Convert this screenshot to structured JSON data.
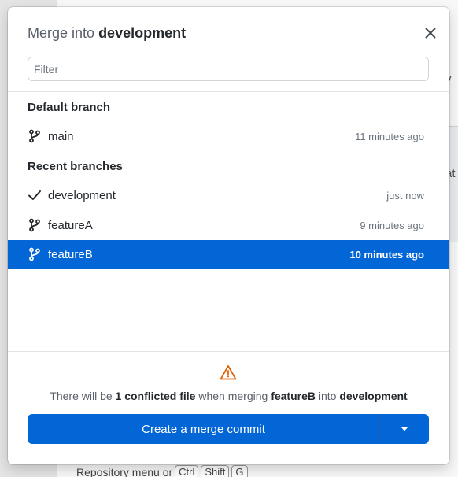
{
  "background": {
    "fragment_a": "y",
    "fragment_b": "at",
    "hint_text": "Repository menu or",
    "hint_keys": [
      "Ctrl",
      "Shift",
      "G"
    ]
  },
  "dialog": {
    "title_prefix": "Merge into",
    "title_branch": "development",
    "close_icon": "close-icon",
    "filter": {
      "placeholder": "Filter",
      "value": ""
    },
    "default_section_label": "Default branch",
    "default_branches": [
      {
        "name": "main",
        "time": "11 minutes ago",
        "icon": "git-branch-icon",
        "selected": false
      }
    ],
    "recent_section_label": "Recent branches",
    "recent_branches": [
      {
        "name": "development",
        "time": "just now",
        "icon": "check-icon",
        "selected": false
      },
      {
        "name": "featureA",
        "time": "9 minutes ago",
        "icon": "git-branch-icon",
        "selected": false
      },
      {
        "name": "featureB",
        "time": "10 minutes ago",
        "icon": "git-branch-icon",
        "selected": true
      }
    ],
    "footer": {
      "warning_icon": "warning-icon",
      "warning_color": "#e36209",
      "msg_part1": "There will be ",
      "msg_conflict": "1 conflicted file",
      "msg_part2": " when merging ",
      "msg_source": "featureB",
      "msg_part3": " into ",
      "msg_target": "development",
      "merge_button_label": "Create a merge commit",
      "dropdown_icon": "triangle-down-icon"
    },
    "accent_color": "#0366d6"
  }
}
